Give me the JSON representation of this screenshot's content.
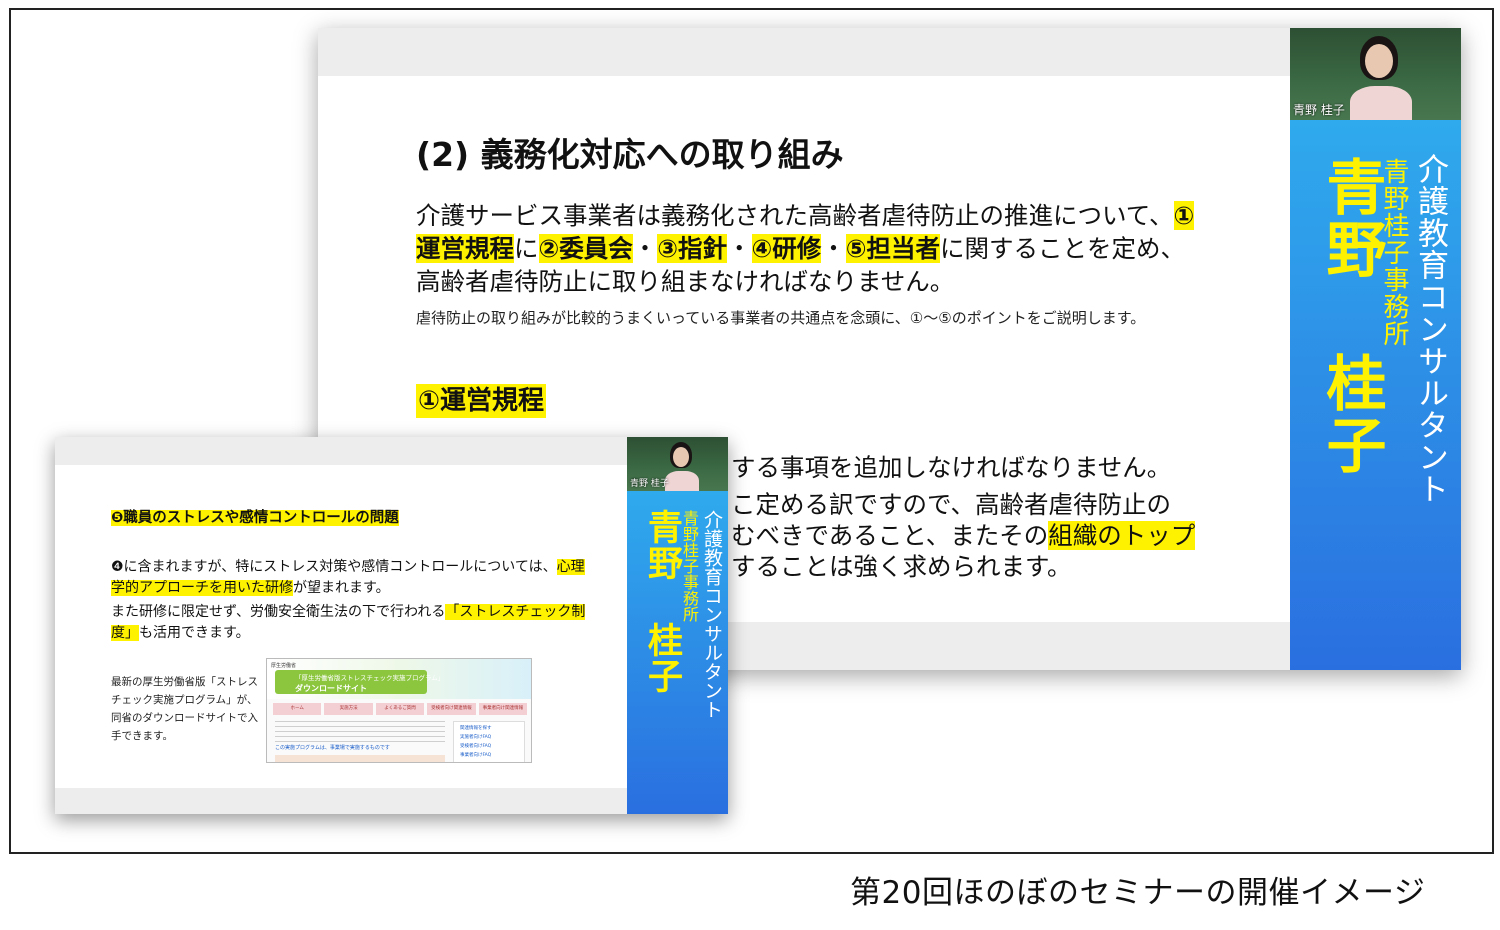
{
  "caption": "第20回ほのぼのセミナーの開催イメージ",
  "presenter": {
    "camera_name": "青野 桂子",
    "title_line": "介護教育コンサルタント",
    "office_line": "青野桂子事務所",
    "name_line": "青野 桂子"
  },
  "colors": {
    "highlight": "#fff200",
    "sidebar_top": "#30b4f0",
    "sidebar_bottom": "#2a6fe0",
    "name_color": "#fff200"
  },
  "main_slide": {
    "title": "(2) 義務化対応への取り組み",
    "body_parts": [
      "介護サービス事業者は義務化された高齢者虐待防止の推進について、",
      "①運営規程",
      "に",
      "②委員会",
      "・",
      "③指針",
      "・",
      "④研修",
      "・",
      "⑤担当者",
      "に関することを定め、高齢者虐待防止に取り組まなければなりません。"
    ],
    "note": "虐待防止の取り組みが比較的うまくいっている事業者の共通点を念頭に、①～⑤のポイントをご説明します。",
    "section": "①運営規程",
    "tail_line1": "する事項を追加しなければなりません。",
    "tail_line2": "こ定める訳ですので、高齢者虐待防止の",
    "tail_line3a": "むべきであること、またその",
    "tail_line3b": "組織のトップ",
    "tail_line4": "することは強く求められます。"
  },
  "small_slide": {
    "heading": "❺職員のストレスや感情コントロールの問題",
    "p1a": "❹に含まれますが、特にストレス対策や感情コントロールについては、",
    "p1b": "心理学的アプローチを用いた研修",
    "p1c": "が望まれます。",
    "p2a": "また研修に限定せず、労働安全衛生法の下で行われる",
    "p2b": "「ストレスチェック制度」",
    "p2c": "も活用できます。",
    "p3": "最新の厚生労働省版「ストレスチェック実施プログラム」が、同省のダウンロードサイトで入手できます。",
    "website": {
      "logo": "厚生労働省",
      "banner_line1": "「厚生労働省版ストレスチェック実施プログラム」",
      "banner_line2": "ダウンロードサイト",
      "nav": [
        "ホーム",
        "実施方法",
        "よくあるご質問",
        "受検者向け関連情報",
        "事業者向け関連情報"
      ],
      "link": "この実施プログラムは、事業場で実施するものです",
      "side_links": [
        "関連情報を探す",
        "実施者向けFAQ",
        "受検者向けFAQ",
        "事業者向けFAQ"
      ]
    }
  }
}
